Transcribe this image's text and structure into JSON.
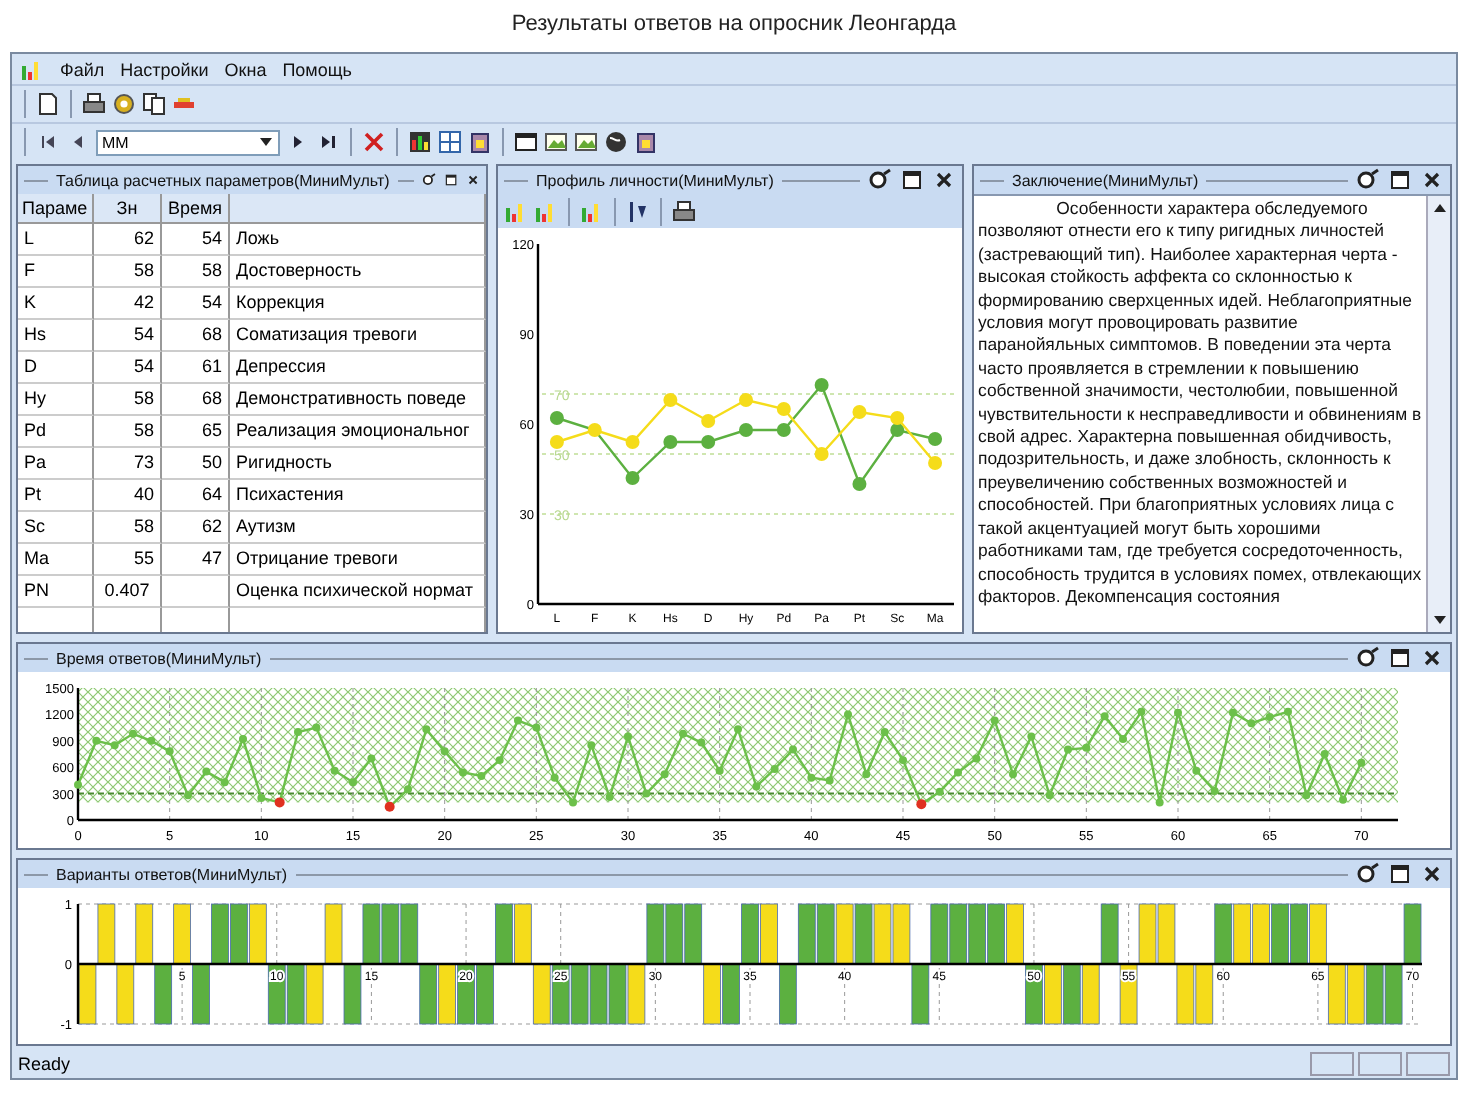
{
  "page_title": "Результаты ответов на опросник Леонгарда",
  "menu": [
    "Файл",
    "Настройки",
    "Окна",
    "Помощь"
  ],
  "nav_combo": {
    "value": "ММ"
  },
  "params_panel": {
    "title": "Таблица расчетных параметров(МиниМульт)",
    "columns": [
      "Параме",
      "Зн",
      "Время"
    ],
    "rows": [
      [
        "L",
        "62",
        "54",
        "Ложь"
      ],
      [
        "F",
        "58",
        "58",
        "Достоверность"
      ],
      [
        "K",
        "42",
        "54",
        "Коррекция"
      ],
      [
        "Hs",
        "54",
        "68",
        "Соматизация тревоги"
      ],
      [
        "D",
        "54",
        "61",
        "Депрессия"
      ],
      [
        "Hy",
        "58",
        "68",
        "Демонстративность поведе"
      ],
      [
        "Pd",
        "58",
        "65",
        "Реализация эмоциональног"
      ],
      [
        "Pa",
        "73",
        "50",
        "Ригидность"
      ],
      [
        "Pt",
        "40",
        "64",
        "Психастения"
      ],
      [
        "Sc",
        "58",
        "62",
        "Аутизм"
      ],
      [
        "Ma",
        "55",
        "47",
        "Отрицание тревоги"
      ],
      [
        "PN",
        "0.407",
        "",
        "Оценка психической нормат"
      ]
    ]
  },
  "profile_panel": {
    "title": "Профиль личности(МиниМульт)",
    "chart_data": {
      "type": "line",
      "categories": [
        "L",
        "F",
        "K",
        "Hs",
        "D",
        "Hy",
        "Pd",
        "Pa",
        "Pt",
        "Sc",
        "Ma"
      ],
      "ylim": [
        0,
        120
      ],
      "yticks": [
        0,
        30,
        60,
        90,
        120
      ],
      "series": [
        {
          "color": "#5cb040",
          "marker": "circle",
          "values": [
            62,
            58,
            42,
            54,
            54,
            58,
            58,
            73,
            40,
            58,
            55
          ]
        },
        {
          "color": "#f5dc1a",
          "marker": "circle",
          "values": [
            54,
            58,
            54,
            68,
            61,
            68,
            65,
            50,
            64,
            62,
            47
          ]
        }
      ],
      "ref_lines": [
        {
          "axis": "y",
          "value": 70,
          "label": "70"
        },
        {
          "axis": "y",
          "value": 50,
          "label": "50"
        },
        {
          "axis": "y",
          "value": 30,
          "label": "30"
        }
      ]
    }
  },
  "conclusion_panel": {
    "title": "Заключение(МиниМульт)",
    "text": "Особенности характера обследуемого позволяют отнести его к типу ригидных личностей (застревающий тип). Наиболее характерная черта - высокая стойкость аффекта со склонностью к формированию сверхценных идей. Неблагоприятные условия могут провоцировать развитие паранойяльных симптомов. В поведении эта черта часто проявляется в стремлении к повышению собственной значимости, честолюбии, повышенной чувствительности к несправедливости и обвинениям в свой адрес. Характерна повышенная обидчивость, подозрительность, и даже злобность, склонность к преувеличению собственных возможностей и способностей. При благоприятных условиях лица с такой акцентуацией могут быть хорошими работниками там, где требуется сосредоточенность, способность трудится в условиях помех, отвлекающих факторов. Декомпенсация состояния"
  },
  "time_panel": {
    "title": "Время ответов(МиниМульт)",
    "chart_data": {
      "type": "line",
      "x": [
        0,
        1,
        2,
        3,
        4,
        5,
        6,
        7,
        8,
        9,
        10,
        11,
        12,
        13,
        14,
        15,
        16,
        17,
        18,
        19,
        20,
        21,
        22,
        23,
        24,
        25,
        26,
        27,
        28,
        29,
        30,
        31,
        32,
        33,
        34,
        35,
        36,
        37,
        38,
        39,
        40,
        41,
        42,
        43,
        44,
        45,
        46,
        47,
        48,
        49,
        50,
        51,
        52,
        53,
        54,
        55,
        56,
        57,
        58,
        59,
        60,
        61,
        62,
        63,
        64,
        65,
        66,
        67,
        68,
        69,
        70
      ],
      "xlim": [
        0,
        72
      ],
      "ylim": [
        0,
        1500
      ],
      "xticks": [
        0,
        5,
        10,
        15,
        20,
        25,
        30,
        35,
        40,
        45,
        50,
        55,
        60,
        65,
        70
      ],
      "yticks": [
        0,
        300,
        600,
        900,
        1200,
        1500
      ],
      "grid": true,
      "series": [
        {
          "color": "#6cc04a",
          "marker": "circle",
          "values": [
            400,
            900,
            850,
            980,
            900,
            780,
            280,
            550,
            430,
            920,
            250,
            200,
            1000,
            1050,
            560,
            430,
            700,
            150,
            350,
            1030,
            780,
            540,
            500,
            680,
            1130,
            1050,
            480,
            200,
            850,
            260,
            950,
            300,
            520,
            980,
            880,
            560,
            1030,
            380,
            580,
            800,
            480,
            450,
            1200,
            520,
            1000,
            680,
            180,
            320,
            540,
            700,
            1130,
            520,
            950,
            280,
            800,
            820,
            1180,
            920,
            1230,
            200,
            1220,
            560,
            330,
            1220,
            1100,
            1170,
            1230,
            280,
            750,
            230,
            650
          ]
        },
        {
          "color": "#e03020",
          "type": "scatter",
          "marker": "circle",
          "values": [
            null,
            null,
            null,
            null,
            null,
            null,
            null,
            null,
            null,
            null,
            null,
            200,
            null,
            null,
            null,
            null,
            null,
            150,
            null,
            null,
            null,
            null,
            null,
            null,
            null,
            null,
            null,
            null,
            null,
            null,
            null,
            null,
            null,
            null,
            null,
            null,
            null,
            null,
            null,
            null,
            null,
            null,
            null,
            null,
            null,
            null,
            180,
            null,
            null,
            null,
            null,
            null,
            null,
            null,
            null,
            null,
            null,
            null,
            null,
            null,
            null,
            null,
            null,
            null,
            null,
            null,
            null,
            null,
            null,
            null,
            null
          ]
        }
      ],
      "bands": [
        {
          "axis": "y",
          "from": 200,
          "to": 1500
        }
      ],
      "ref_lines": [
        {
          "axis": "y",
          "value": 300
        }
      ]
    }
  },
  "answers_panel": {
    "title": "Варианты ответов(МиниМульт)",
    "chart_data": {
      "type": "bar",
      "x": [
        0,
        1,
        2,
        3,
        4,
        5,
        6,
        7,
        8,
        9,
        10,
        11,
        12,
        13,
        14,
        15,
        16,
        17,
        18,
        19,
        20,
        21,
        22,
        23,
        24,
        25,
        26,
        27,
        28,
        29,
        30,
        31,
        32,
        33,
        34,
        35,
        36,
        37,
        38,
        39,
        40,
        41,
        42,
        43,
        44,
        45,
        46,
        47,
        48,
        49,
        50,
        51,
        52,
        53,
        54,
        55,
        56,
        57,
        58,
        59,
        60,
        61,
        62,
        63,
        64,
        65,
        66,
        67,
        68,
        69,
        70
      ],
      "grid": true,
      "xlim": [
        -0.5,
        70.5
      ],
      "ylim": [
        -1,
        1
      ],
      "yticks": [
        -1,
        0,
        1
      ],
      "xticks": [
        5,
        10,
        15,
        20,
        25,
        30,
        35,
        40,
        45,
        50,
        55,
        60,
        65,
        70
      ],
      "series": [
        {
          "color": "#f5dc1a",
          "values": [
            -1,
            1,
            -1,
            1,
            null,
            1,
            null,
            null,
            null,
            1,
            null,
            null,
            -1,
            1,
            null,
            null,
            null,
            null,
            null,
            -1,
            null,
            null,
            null,
            1,
            -1,
            null,
            null,
            null,
            null,
            -1,
            null,
            null,
            null,
            -1,
            null,
            null,
            1,
            null,
            null,
            null,
            1,
            null,
            1,
            1,
            null,
            null,
            null,
            null,
            null,
            1,
            null,
            -1,
            null,
            -1,
            null,
            -1,
            1,
            1,
            -1,
            -1,
            null,
            1,
            1,
            null,
            null,
            1,
            -1,
            -1,
            null,
            null,
            null
          ]
        },
        {
          "color": "#5cb040",
          "values": [
            null,
            null,
            null,
            null,
            -1,
            null,
            -1,
            1,
            1,
            null,
            -1,
            -1,
            null,
            null,
            -1,
            1,
            1,
            1,
            -1,
            null,
            -1,
            -1,
            1,
            null,
            null,
            -1,
            -1,
            -1,
            -1,
            null,
            1,
            1,
            1,
            null,
            -1,
            1,
            null,
            -1,
            1,
            1,
            null,
            1,
            null,
            null,
            -1,
            1,
            1,
            1,
            1,
            null,
            -1,
            null,
            -1,
            null,
            1,
            null,
            null,
            null,
            null,
            null,
            1,
            null,
            null,
            1,
            1,
            null,
            null,
            null,
            -1,
            -1,
            1
          ]
        }
      ]
    }
  },
  "status_bar": {
    "text": "Ready"
  }
}
